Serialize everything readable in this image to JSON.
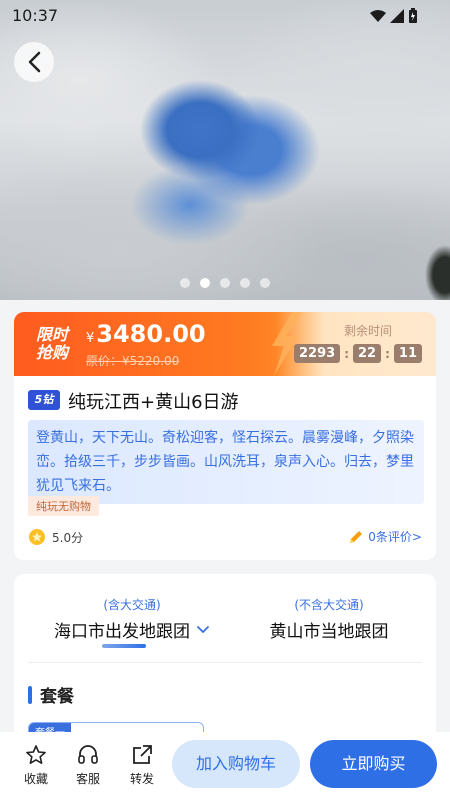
{
  "status": {
    "time": "10:37"
  },
  "carousel": {
    "dots": 5,
    "active": 1
  },
  "price": {
    "flash_label": "限时抢购",
    "currency": "¥",
    "now": "3480.00",
    "original": "原价：¥5220.00",
    "remain_label": "剩余时间",
    "timer": [
      "2293",
      "22",
      "11"
    ]
  },
  "product": {
    "badge": "5钻",
    "title": "纯玩江西+黄山6日游",
    "description": "登黄山，天下无山。奇松迎客，怪石探云。晨雾漫峰，夕照染峦。拾级三千，步步皆画。山风洗耳，泉声入心。归去，梦里犹见飞来石。",
    "tag": "纯玩无购物",
    "score": "5.0分",
    "reviews": "0条评价>"
  },
  "tour_types": [
    {
      "sub": "(含大交通)",
      "main": "海口市出发地跟团"
    },
    {
      "sub": "(不含大交通)",
      "main": "黄山市当地跟团"
    }
  ],
  "section_title": "套餐",
  "package_label": "套餐一",
  "bottom": {
    "favorite": "收藏",
    "service": "客服",
    "share": "转发",
    "add_cart": "加入购物车",
    "buy_now": "立即购买"
  }
}
